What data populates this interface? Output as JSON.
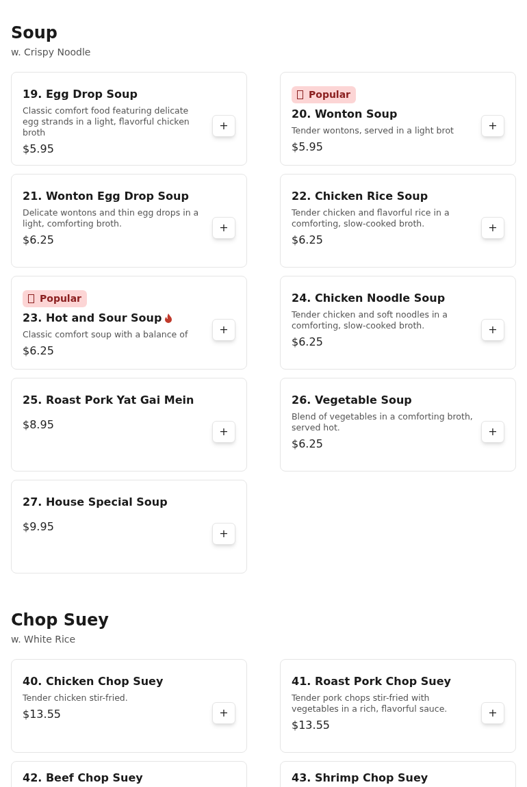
{
  "sections": [
    {
      "title": "Soup",
      "subtitle": "w. Crispy Noodle",
      "items": [
        {
          "name": "19. Egg Drop Soup",
          "description": "Classic comfort food featuring delicate egg strands in a light, flavorful chicken broth",
          "price": "$5.95",
          "popular": false,
          "spicy": false,
          "add": "+"
        },
        {
          "name": "20. Wonton Soup",
          "description": "Tender wontons, served in a light brot",
          "price": "$5.95",
          "popular": true,
          "badge": "Popular",
          "spicy": false,
          "add": "+"
        },
        {
          "name": "21. Wonton Egg Drop Soup",
          "description": "Delicate wontons and thin egg drops in a light, comforting broth.",
          "price": "$6.25",
          "popular": false,
          "spicy": false,
          "add": "+"
        },
        {
          "name": "22. Chicken Rice Soup",
          "description": "Tender chicken and flavorful rice in a comforting, slow-cooked broth.",
          "price": "$6.25",
          "popular": false,
          "spicy": false,
          "add": "+"
        },
        {
          "name": "23. Hot and Sour Soup",
          "description": "Classic comfort soup with a balance of",
          "price": "$6.25",
          "popular": true,
          "badge": "Popular",
          "spicy": true,
          "add": "+"
        },
        {
          "name": "24. Chicken Noodle Soup",
          "description": "Tender chicken and soft noodles in a comforting, slow-cooked broth.",
          "price": "$6.25",
          "popular": false,
          "spicy": false,
          "add": "+"
        },
        {
          "name": "25. Roast Pork Yat Gai Mein",
          "price": "$8.95",
          "popular": false,
          "spicy": false,
          "add": "+"
        },
        {
          "name": "26. Vegetable Soup",
          "description": "Blend of vegetables in a comforting broth, served hot.",
          "price": "$6.25",
          "popular": false,
          "spicy": false,
          "add": "+"
        },
        {
          "name": "27. House Special Soup",
          "price": "$9.95",
          "popular": false,
          "spicy": false,
          "add": "+"
        }
      ]
    },
    {
      "title": "Chop Suey",
      "subtitle": "w. White Rice",
      "items": [
        {
          "name": "40. Chicken Chop Suey",
          "description": "Tender chicken stir-fried.",
          "price": "$13.55",
          "popular": false,
          "spicy": false,
          "add": "+"
        },
        {
          "name": "41. Roast Pork Chop Suey",
          "description": "Tender pork chops stir-fried with vegetables in a rich, flavorful sauce.",
          "price": "$13.55",
          "popular": false,
          "spicy": false,
          "add": "+"
        },
        {
          "name": "42. Beef Chop Suey",
          "popular": false,
          "spicy": false
        },
        {
          "name": "43. Shrimp Chop Suey",
          "popular": false,
          "spicy": false
        }
      ]
    }
  ]
}
